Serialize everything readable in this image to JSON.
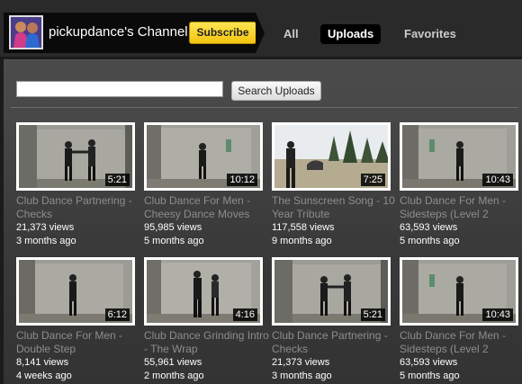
{
  "header": {
    "channel_name": "pickupdance's Channel",
    "subscribe_label": "Subscribe",
    "tabs": [
      {
        "label": "All"
      },
      {
        "label": "Uploads"
      },
      {
        "label": "Favorites"
      }
    ]
  },
  "search": {
    "value": "",
    "button_label": "Search Uploads"
  },
  "videos": [
    {
      "title": "Club Dance Partnering - Checks",
      "views": "21,373 views",
      "age": "3 months ago",
      "duration": "5:21"
    },
    {
      "title": "Club Dance For Men - Cheesy Dance Moves",
      "views": "95,985 views",
      "age": "5 months ago",
      "duration": "10:12"
    },
    {
      "title": "The Sunscreen Song - 10 Year Tribute",
      "views": "117,558 views",
      "age": "9 months ago",
      "duration": "7:25"
    },
    {
      "title": "Club Dance For Men - Sidesteps (Level 2",
      "views": "63,593 views",
      "age": "5 months ago",
      "duration": "10:43"
    },
    {
      "title": "Club Dance For Men - Double Step",
      "views": "8,141 views",
      "age": "4 weeks ago",
      "duration": "6:12"
    },
    {
      "title": "Club Dance Grinding Intro - The Wrap",
      "views": "55,961 views",
      "age": "2 months ago",
      "duration": "4:16"
    },
    {
      "title": "Club Dance Partnering - Checks",
      "views": "21,373 views",
      "age": "3 months ago",
      "duration": "5:21"
    },
    {
      "title": "Club Dance For Men - Sidesteps (Level 2",
      "views": "63,593 views",
      "age": "5 months ago",
      "duration": "10:43"
    }
  ]
}
